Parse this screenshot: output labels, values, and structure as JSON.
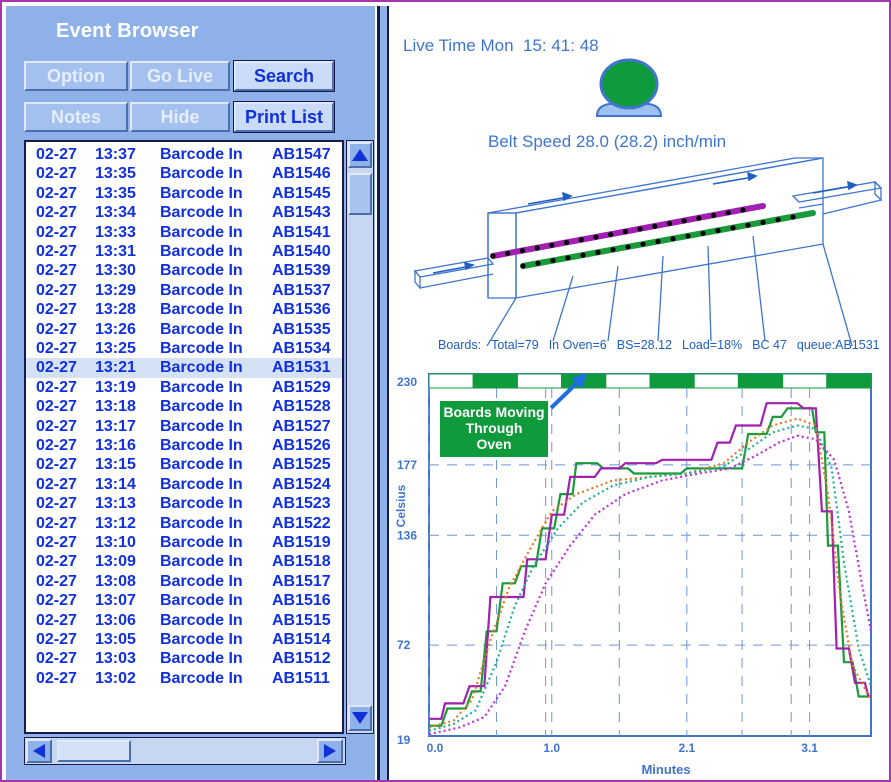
{
  "event_browser": {
    "title": "Event Browser",
    "buttons": {
      "option": "Option",
      "go_live": "Go Live",
      "search": "Search",
      "notes": "Notes",
      "hide": "Hide",
      "print_list": "Print List"
    },
    "events": [
      {
        "date": "02-27",
        "time": "13:37",
        "type": "Barcode In",
        "id": "AB1547"
      },
      {
        "date": "02-27",
        "time": "13:35",
        "type": "Barcode In",
        "id": "AB1546"
      },
      {
        "date": "02-27",
        "time": "13:35",
        "type": "Barcode In",
        "id": "AB1545"
      },
      {
        "date": "02-27",
        "time": "13:34",
        "type": "Barcode In",
        "id": "AB1543"
      },
      {
        "date": "02-27",
        "time": "13:33",
        "type": "Barcode In",
        "id": "AB1541"
      },
      {
        "date": "02-27",
        "time": "13:31",
        "type": "Barcode In",
        "id": "AB1540"
      },
      {
        "date": "02-27",
        "time": "13:30",
        "type": "Barcode In",
        "id": "AB1539"
      },
      {
        "date": "02-27",
        "time": "13:29",
        "type": "Barcode In",
        "id": "AB1537"
      },
      {
        "date": "02-27",
        "time": "13:28",
        "type": "Barcode In",
        "id": "AB1536"
      },
      {
        "date": "02-27",
        "time": "13:26",
        "type": "Barcode In",
        "id": "AB1535"
      },
      {
        "date": "02-27",
        "time": "13:25",
        "type": "Barcode In",
        "id": "AB1534"
      },
      {
        "date": "02-27",
        "time": "13:21",
        "type": "Barcode In",
        "id": "AB1531"
      },
      {
        "date": "02-27",
        "time": "13:19",
        "type": "Barcode In",
        "id": "AB1529"
      },
      {
        "date": "02-27",
        "time": "13:18",
        "type": "Barcode In",
        "id": "AB1528"
      },
      {
        "date": "02-27",
        "time": "13:17",
        "type": "Barcode In",
        "id": "AB1527"
      },
      {
        "date": "02-27",
        "time": "13:16",
        "type": "Barcode In",
        "id": "AB1526"
      },
      {
        "date": "02-27",
        "time": "13:15",
        "type": "Barcode In",
        "id": "AB1525"
      },
      {
        "date": "02-27",
        "time": "13:14",
        "type": "Barcode In",
        "id": "AB1524"
      },
      {
        "date": "02-27",
        "time": "13:13",
        "type": "Barcode In",
        "id": "AB1523"
      },
      {
        "date": "02-27",
        "time": "13:12",
        "type": "Barcode In",
        "id": "AB1522"
      },
      {
        "date": "02-27",
        "time": "13:10",
        "type": "Barcode In",
        "id": "AB1519"
      },
      {
        "date": "02-27",
        "time": "13:09",
        "type": "Barcode In",
        "id": "AB1518"
      },
      {
        "date": "02-27",
        "time": "13:08",
        "type": "Barcode In",
        "id": "AB1517"
      },
      {
        "date": "02-27",
        "time": "13:07",
        "type": "Barcode In",
        "id": "AB1516"
      },
      {
        "date": "02-27",
        "time": "13:06",
        "type": "Barcode In",
        "id": "AB1515"
      },
      {
        "date": "02-27",
        "time": "13:05",
        "type": "Barcode In",
        "id": "AB1514"
      },
      {
        "date": "02-27",
        "time": "13:03",
        "type": "Barcode In",
        "id": "AB1512"
      },
      {
        "date": "02-27",
        "time": "13:02",
        "type": "Barcode In",
        "id": "AB1511"
      }
    ],
    "selected_index": 11
  },
  "live": {
    "time_label": "Live Time Mon",
    "time_value": "15: 41: 48",
    "status_color": "#0f9a3c",
    "belt_speed": "Belt Speed 28.0 (28.2) inch/min"
  },
  "stats": {
    "boards": "Boards:",
    "total": "Total=79",
    "in_oven": "In Oven=6",
    "bs": "BS=28.12",
    "load": "Load=18%",
    "bc": "BC 47",
    "queue": "queue:AB1531"
  },
  "callout": {
    "line1": "Boards Moving",
    "line2": "Through",
    "line3": "Oven"
  },
  "colors": {
    "panel": "#8fb1ea",
    "list_text": "#1030e0",
    "accent_purple": "#a436b0",
    "oven_green": "#0f9a3c"
  },
  "chart_data": {
    "type": "line",
    "xlabel": "Minutes",
    "ylabel": "Celsius",
    "x_ticks": [
      "0.0",
      "1.0",
      "2.1",
      "3.1"
    ],
    "x_tick_values": [
      0.0,
      1.0,
      2.1,
      3.1
    ],
    "y_ticks": [
      "19",
      "72",
      "136",
      "177",
      "230"
    ],
    "y_tick_values": [
      19,
      72,
      136,
      177,
      230
    ],
    "xlim": [
      0,
      3.6
    ],
    "ylim": [
      19,
      230
    ],
    "grid": true,
    "series": [
      {
        "color": "#1a9a3a",
        "style": "step",
        "points": [
          [
            0.0,
            25
          ],
          [
            0.1,
            25
          ],
          [
            0.15,
            35
          ],
          [
            0.3,
            35
          ],
          [
            0.35,
            45
          ],
          [
            0.42,
            45
          ],
          [
            0.47,
            80
          ],
          [
            0.55,
            80
          ],
          [
            0.6,
            108
          ],
          [
            0.7,
            108
          ],
          [
            0.75,
            118
          ],
          [
            0.87,
            118
          ],
          [
            0.92,
            140
          ],
          [
            1.02,
            140
          ],
          [
            1.07,
            160
          ],
          [
            1.17,
            160
          ],
          [
            1.2,
            178
          ],
          [
            1.37,
            178
          ],
          [
            1.42,
            175
          ],
          [
            1.62,
            175
          ],
          [
            1.67,
            172
          ],
          [
            2.05,
            172
          ],
          [
            2.1,
            175
          ],
          [
            2.55,
            175
          ],
          [
            2.6,
            195
          ],
          [
            2.75,
            195
          ],
          [
            2.8,
            205
          ],
          [
            2.87,
            205
          ],
          [
            2.92,
            210
          ],
          [
            3.12,
            210
          ],
          [
            3.15,
            196
          ],
          [
            3.22,
            196
          ],
          [
            3.25,
            130
          ],
          [
            3.33,
            130
          ],
          [
            3.38,
            62
          ],
          [
            3.45,
            62
          ],
          [
            3.5,
            42
          ],
          [
            3.6,
            42
          ]
        ]
      },
      {
        "color": "#a020b0",
        "style": "step",
        "points": [
          [
            0.0,
            29
          ],
          [
            0.1,
            29
          ],
          [
            0.13,
            38
          ],
          [
            0.28,
            38
          ],
          [
            0.33,
            48
          ],
          [
            0.45,
            48
          ],
          [
            0.5,
            100
          ],
          [
            0.77,
            100
          ],
          [
            0.8,
            122
          ],
          [
            0.95,
            122
          ],
          [
            1.0,
            148
          ],
          [
            1.1,
            148
          ],
          [
            1.15,
            170
          ],
          [
            1.35,
            170
          ],
          [
            1.4,
            175
          ],
          [
            1.55,
            175
          ],
          [
            1.6,
            178
          ],
          [
            1.85,
            178
          ],
          [
            1.9,
            180
          ],
          [
            2.3,
            180
          ],
          [
            2.35,
            190
          ],
          [
            2.45,
            190
          ],
          [
            2.5,
            200
          ],
          [
            2.7,
            200
          ],
          [
            2.75,
            213
          ],
          [
            3.0,
            213
          ],
          [
            3.05,
            210
          ],
          [
            3.15,
            210
          ],
          [
            3.2,
            150
          ],
          [
            3.28,
            150
          ],
          [
            3.32,
            70
          ],
          [
            3.42,
            70
          ],
          [
            3.47,
            50
          ],
          [
            3.55,
            50
          ],
          [
            3.58,
            42
          ],
          [
            3.6,
            42
          ]
        ]
      },
      {
        "color": "#e87820",
        "style": "dotted",
        "points": [
          [
            0.0,
            24
          ],
          [
            0.2,
            28
          ],
          [
            0.35,
            40
          ],
          [
            0.5,
            75
          ],
          [
            0.65,
            105
          ],
          [
            0.8,
            125
          ],
          [
            1.0,
            150
          ],
          [
            1.2,
            160
          ],
          [
            1.5,
            168
          ],
          [
            1.8,
            170
          ],
          [
            2.1,
            172
          ],
          [
            2.4,
            178
          ],
          [
            2.6,
            190
          ],
          [
            2.8,
            200
          ],
          [
            3.0,
            204
          ],
          [
            3.15,
            200
          ],
          [
            3.25,
            160
          ],
          [
            3.35,
            100
          ],
          [
            3.45,
            60
          ],
          [
            3.6,
            40
          ]
        ]
      },
      {
        "color": "#20b090",
        "style": "dotted",
        "points": [
          [
            0.0,
            22
          ],
          [
            0.2,
            26
          ],
          [
            0.38,
            34
          ],
          [
            0.55,
            62
          ],
          [
            0.7,
            95
          ],
          [
            0.85,
            118
          ],
          [
            1.05,
            140
          ],
          [
            1.25,
            155
          ],
          [
            1.5,
            165
          ],
          [
            1.8,
            170
          ],
          [
            2.1,
            172
          ],
          [
            2.4,
            176
          ],
          [
            2.6,
            186
          ],
          [
            2.8,
            196
          ],
          [
            3.0,
            200
          ],
          [
            3.15,
            198
          ],
          [
            3.28,
            175
          ],
          [
            3.38,
            120
          ],
          [
            3.5,
            70
          ],
          [
            3.6,
            48
          ]
        ]
      },
      {
        "color": "#c030d8",
        "style": "dotted",
        "points": [
          [
            0.0,
            20
          ],
          [
            0.25,
            24
          ],
          [
            0.45,
            30
          ],
          [
            0.62,
            48
          ],
          [
            0.78,
            80
          ],
          [
            0.95,
            108
          ],
          [
            1.15,
            130
          ],
          [
            1.35,
            148
          ],
          [
            1.6,
            160
          ],
          [
            1.9,
            168
          ],
          [
            2.2,
            172
          ],
          [
            2.45,
            175
          ],
          [
            2.65,
            182
          ],
          [
            2.85,
            190
          ],
          [
            3.0,
            194
          ],
          [
            3.15,
            192
          ],
          [
            3.3,
            180
          ],
          [
            3.42,
            150
          ],
          [
            3.52,
            110
          ],
          [
            3.6,
            80
          ]
        ]
      }
    ]
  }
}
